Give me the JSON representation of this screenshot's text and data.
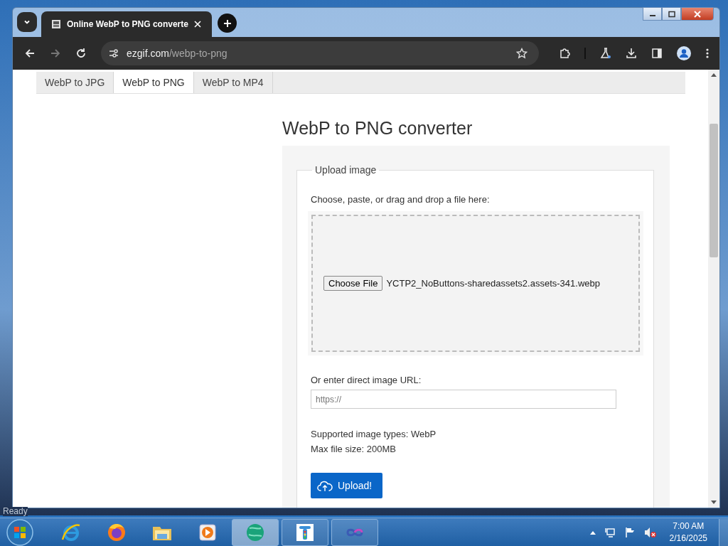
{
  "browser": {
    "tab": {
      "title": "Online WebP to PNG converte"
    },
    "address": {
      "domain": "ezgif.com",
      "path": "/webp-to-png"
    }
  },
  "page": {
    "tabs": [
      {
        "label": "WebP to JPG",
        "selected": false
      },
      {
        "label": "WebP to PNG",
        "selected": true
      },
      {
        "label": "WebP to MP4",
        "selected": false
      }
    ],
    "heading": "WebP to PNG converter",
    "upload": {
      "legend": "Upload image",
      "prompt": "Choose, paste, or drag and drop a file here:",
      "choose_button": "Choose File",
      "file_name": "YCTP2_NoButtons-sharedassets2.assets-341.webp",
      "url_label": "Or enter direct image URL:",
      "url_placeholder": "https://",
      "supported": "Supported image types: WebP",
      "max_size": "Max file size: 200MB",
      "upload_button": "Upload!"
    }
  },
  "background_status": "Ready",
  "taskbar": {
    "apps": [
      {
        "kind": "ie",
        "running": false,
        "selected": false
      },
      {
        "kind": "firefox",
        "running": false,
        "selected": false
      },
      {
        "kind": "folder",
        "running": false,
        "selected": false
      },
      {
        "kind": "media",
        "running": false,
        "selected": false
      },
      {
        "kind": "globe",
        "running": true,
        "selected": true
      },
      {
        "kind": "signal",
        "running": true,
        "selected": false
      },
      {
        "kind": "infinity",
        "running": true,
        "selected": false
      }
    ],
    "clock": {
      "time": "7:00 AM",
      "date": "2/16/2025"
    }
  }
}
